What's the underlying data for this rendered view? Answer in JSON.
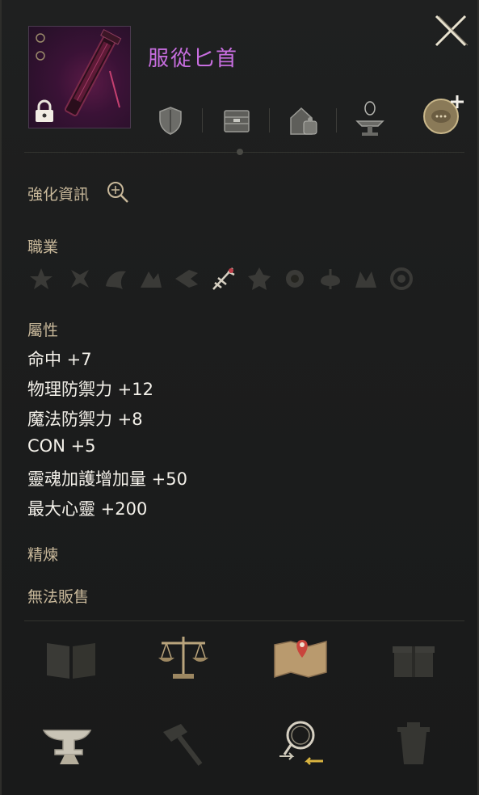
{
  "item": {
    "name": "服從匕首",
    "locked": true
  },
  "sections": {
    "enhance_label": "強化資訊",
    "class_label": "職業",
    "attributes_label": "屬性",
    "refine_label": "精煉",
    "sell_status": "無法販售"
  },
  "attributes": [
    {
      "text": "命中 +7"
    },
    {
      "text": "物理防禦力 +12"
    },
    {
      "text": "魔法防禦力 +8"
    },
    {
      "text": "CON +5"
    },
    {
      "text": "靈魂加護增加量 +50"
    },
    {
      "text": "最大心靈 +200"
    }
  ],
  "classes": [
    {
      "icon": "class-icon-1",
      "active": false
    },
    {
      "icon": "class-icon-2",
      "active": false
    },
    {
      "icon": "class-icon-3",
      "active": false
    },
    {
      "icon": "class-icon-4",
      "active": false
    },
    {
      "icon": "class-icon-5",
      "active": false
    },
    {
      "icon": "class-icon-6",
      "active": true
    },
    {
      "icon": "class-icon-7",
      "active": false
    },
    {
      "icon": "class-icon-8",
      "active": false
    },
    {
      "icon": "class-icon-9",
      "active": false
    },
    {
      "icon": "class-icon-10",
      "active": false
    },
    {
      "icon": "class-icon-11",
      "active": false
    }
  ],
  "colors": {
    "item_name": "#c86ee0",
    "label": "#c8b89a",
    "text": "#f4f1ea",
    "background": "#1c1d1d"
  }
}
